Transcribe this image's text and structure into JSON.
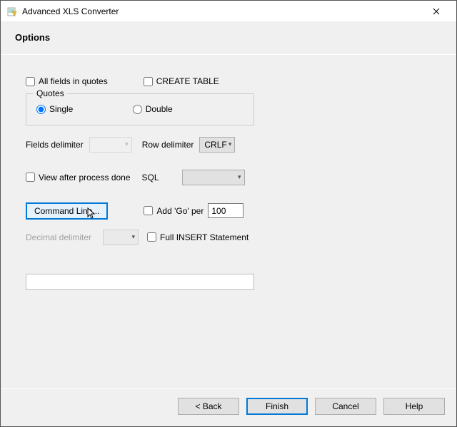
{
  "window": {
    "title": "Advanced XLS Converter"
  },
  "header": {
    "title": "Options"
  },
  "options": {
    "all_fields_in_quotes": {
      "label": "All fields in quotes",
      "checked": false
    },
    "create_table": {
      "label": "CREATE TABLE",
      "checked": false
    },
    "quotes_group": {
      "legend": "Quotes",
      "single": {
        "label": "Single",
        "checked": true
      },
      "double": {
        "label": "Double",
        "checked": false
      }
    },
    "fields_delimiter": {
      "label": "Fields delimiter",
      "value": ""
    },
    "row_delimiter": {
      "label": "Row delimiter",
      "value": "CRLF"
    },
    "view_after": {
      "label": "View after process done",
      "checked": false
    },
    "sql": {
      "label": "SQL",
      "value": ""
    },
    "command_line": {
      "label": "Command Line..."
    },
    "add_go": {
      "label": "Add 'Go' per",
      "checked": false,
      "value": "100"
    },
    "decimal_delimiter": {
      "label": "Decimal delimiter",
      "value": ""
    },
    "full_insert": {
      "label": "Full INSERT Statement",
      "checked": false
    },
    "path_input": {
      "value": ""
    }
  },
  "buttons": {
    "back": "< Back",
    "finish": "Finish",
    "cancel": "Cancel",
    "help": "Help"
  }
}
